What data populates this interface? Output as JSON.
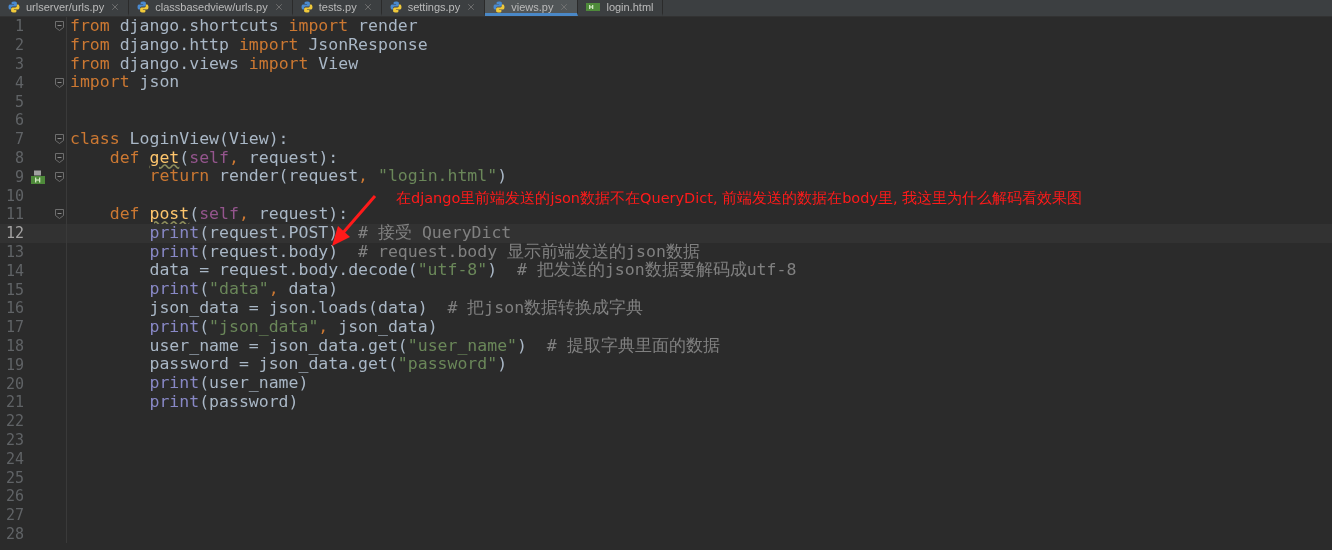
{
  "tabs": [
    {
      "label": "urlserver/urls.py",
      "kind": "python",
      "selected": false
    },
    {
      "label": "classbasedview/urls.py",
      "kind": "python",
      "selected": false
    },
    {
      "label": "tests.py",
      "kind": "python",
      "selected": false
    },
    {
      "label": "settings.py",
      "kind": "python",
      "selected": false
    },
    {
      "label": "views.py",
      "kind": "python",
      "selected": true
    },
    {
      "label": "login.html",
      "kind": "html",
      "selected": false
    }
  ],
  "lines": [
    {
      "number": "1",
      "fold": true,
      "gutter_marker": false,
      "current": false,
      "tokens": [
        {
          "kind": "kw",
          "text": "from"
        },
        {
          "kind": "plain",
          "text": " django.shortcuts "
        },
        {
          "kind": "kw",
          "text": "import"
        },
        {
          "kind": "plain",
          "text": " render"
        }
      ]
    },
    {
      "number": "2",
      "fold": false,
      "gutter_marker": false,
      "current": false,
      "tokens": [
        {
          "kind": "kw",
          "text": "from"
        },
        {
          "kind": "plain",
          "text": " django.http "
        },
        {
          "kind": "kw",
          "text": "import"
        },
        {
          "kind": "plain",
          "text": " JsonResponse"
        }
      ]
    },
    {
      "number": "3",
      "fold": false,
      "gutter_marker": false,
      "current": false,
      "tokens": [
        {
          "kind": "kw",
          "text": "from"
        },
        {
          "kind": "plain",
          "text": " django.views "
        },
        {
          "kind": "kw",
          "text": "import"
        },
        {
          "kind": "plain",
          "text": " View"
        }
      ]
    },
    {
      "number": "4",
      "fold": true,
      "gutter_marker": false,
      "current": false,
      "tokens": [
        {
          "kind": "kw",
          "text": "import"
        },
        {
          "kind": "plain",
          "text": " json"
        }
      ]
    },
    {
      "number": "5",
      "fold": false,
      "gutter_marker": false,
      "current": false
    },
    {
      "number": "6",
      "fold": false,
      "gutter_marker": false,
      "current": false
    },
    {
      "number": "7",
      "fold": true,
      "gutter_marker": false,
      "current": false,
      "tokens": [
        {
          "kind": "kw",
          "text": "class"
        },
        {
          "kind": "plain",
          "text": " LoginView(View):"
        }
      ]
    },
    {
      "number": "8",
      "fold": true,
      "gutter_marker": false,
      "current": false,
      "tokens": [
        {
          "kind": "kw",
          "text": "    def "
        },
        {
          "kind": "fn",
          "text": "get"
        },
        {
          "kind": "plain",
          "text": "("
        },
        {
          "kind": "self",
          "text": "self"
        },
        {
          "kind": "kw",
          "text": ","
        },
        {
          "kind": "plain",
          "text": " request):"
        }
      ]
    },
    {
      "number": "9",
      "fold": true,
      "gutter_marker": true,
      "current": false,
      "tokens": [
        {
          "kind": "kw",
          "text": "        return"
        },
        {
          "kind": "plain",
          "text": " render(request"
        },
        {
          "kind": "kw",
          "text": ","
        },
        {
          "kind": "str",
          "text": " \"login.html\""
        },
        {
          "kind": "plain",
          "text": ")"
        }
      ]
    },
    {
      "number": "10",
      "fold": false,
      "gutter_marker": false,
      "current": false
    },
    {
      "number": "11",
      "fold": true,
      "gutter_marker": false,
      "current": false,
      "tokens": [
        {
          "kind": "kw",
          "text": "    def "
        },
        {
          "kind": "fn",
          "text": "post"
        },
        {
          "kind": "plain",
          "text": "("
        },
        {
          "kind": "self",
          "text": "self"
        },
        {
          "kind": "kw",
          "text": ","
        },
        {
          "kind": "plain",
          "text": " request):"
        }
      ]
    },
    {
      "number": "12",
      "fold": false,
      "gutter_marker": false,
      "current": true,
      "tokens": [
        {
          "kind": "builtin",
          "text": "        print"
        },
        {
          "kind": "plain",
          "text": "(request.POST)  "
        },
        {
          "kind": "comment",
          "text": "# 接受 QueryDict"
        }
      ]
    },
    {
      "number": "13",
      "fold": false,
      "gutter_marker": false,
      "current": false,
      "tokens": [
        {
          "kind": "builtin",
          "text": "        print"
        },
        {
          "kind": "plain",
          "text": "(request.body)  "
        },
        {
          "kind": "comment",
          "text": "# request.body 显示前端发送的json数据"
        }
      ]
    },
    {
      "number": "14",
      "fold": false,
      "gutter_marker": false,
      "current": false,
      "tokens": [
        {
          "kind": "plain",
          "text": "        data = request.body.decode("
        },
        {
          "kind": "str",
          "text": "\"utf-8\""
        },
        {
          "kind": "plain",
          "text": ")  "
        },
        {
          "kind": "comment",
          "text": "# 把发送的json数据要解码成utf-8"
        }
      ]
    },
    {
      "number": "15",
      "fold": false,
      "gutter_marker": false,
      "current": false,
      "tokens": [
        {
          "kind": "builtin",
          "text": "        print"
        },
        {
          "kind": "plain",
          "text": "("
        },
        {
          "kind": "str",
          "text": "\"data\""
        },
        {
          "kind": "kw",
          "text": ","
        },
        {
          "kind": "plain",
          "text": " data)"
        }
      ]
    },
    {
      "number": "16",
      "fold": false,
      "gutter_marker": false,
      "current": false,
      "tokens": [
        {
          "kind": "plain",
          "text": "        json_data = json.loads(data)  "
        },
        {
          "kind": "comment",
          "text": "# 把json数据转换成字典"
        }
      ]
    },
    {
      "number": "17",
      "fold": false,
      "gutter_marker": false,
      "current": false,
      "tokens": [
        {
          "kind": "builtin",
          "text": "        print"
        },
        {
          "kind": "plain",
          "text": "("
        },
        {
          "kind": "str",
          "text": "\"json_data\""
        },
        {
          "kind": "kw",
          "text": ","
        },
        {
          "kind": "plain",
          "text": " json_data)"
        }
      ]
    },
    {
      "number": "18",
      "fold": false,
      "gutter_marker": false,
      "current": false,
      "tokens": [
        {
          "kind": "plain",
          "text": "        user_name = json_data.get("
        },
        {
          "kind": "str",
          "text": "\"user_name\""
        },
        {
          "kind": "plain",
          "text": ")  "
        },
        {
          "kind": "comment",
          "text": "# 提取字典里面的数据"
        }
      ]
    },
    {
      "number": "19",
      "fold": false,
      "gutter_marker": false,
      "current": false,
      "tokens": [
        {
          "kind": "plain",
          "text": "        password = json_data.get("
        },
        {
          "kind": "str",
          "text": "\"password\""
        },
        {
          "kind": "plain",
          "text": ")"
        }
      ]
    },
    {
      "number": "20",
      "fold": false,
      "gutter_marker": false,
      "current": false,
      "tokens": [
        {
          "kind": "builtin",
          "text": "        print"
        },
        {
          "kind": "plain",
          "text": "(user_name)"
        }
      ]
    },
    {
      "number": "21",
      "fold": false,
      "gutter_marker": false,
      "current": false,
      "tokens": [
        {
          "kind": "builtin",
          "text": "        print"
        },
        {
          "kind": "plain",
          "text": "(password)"
        }
      ]
    },
    {
      "number": "22",
      "fold": false,
      "gutter_marker": false,
      "current": false
    },
    {
      "number": "23",
      "fold": false,
      "gutter_marker": false,
      "current": false
    },
    {
      "number": "24",
      "fold": false,
      "gutter_marker": false,
      "current": false
    },
    {
      "number": "25",
      "fold": false,
      "gutter_marker": false,
      "current": false
    },
    {
      "number": "26",
      "fold": false,
      "gutter_marker": false,
      "current": false
    },
    {
      "number": "27",
      "fold": false,
      "gutter_marker": false,
      "current": false
    },
    {
      "number": "28",
      "fold": false,
      "gutter_marker": false,
      "current": false
    }
  ],
  "annotation": {
    "text": "在django里前端发送的json数据不在QueryDict, 前端发送的数据在body里, 我这里为什么解码看效果图"
  }
}
